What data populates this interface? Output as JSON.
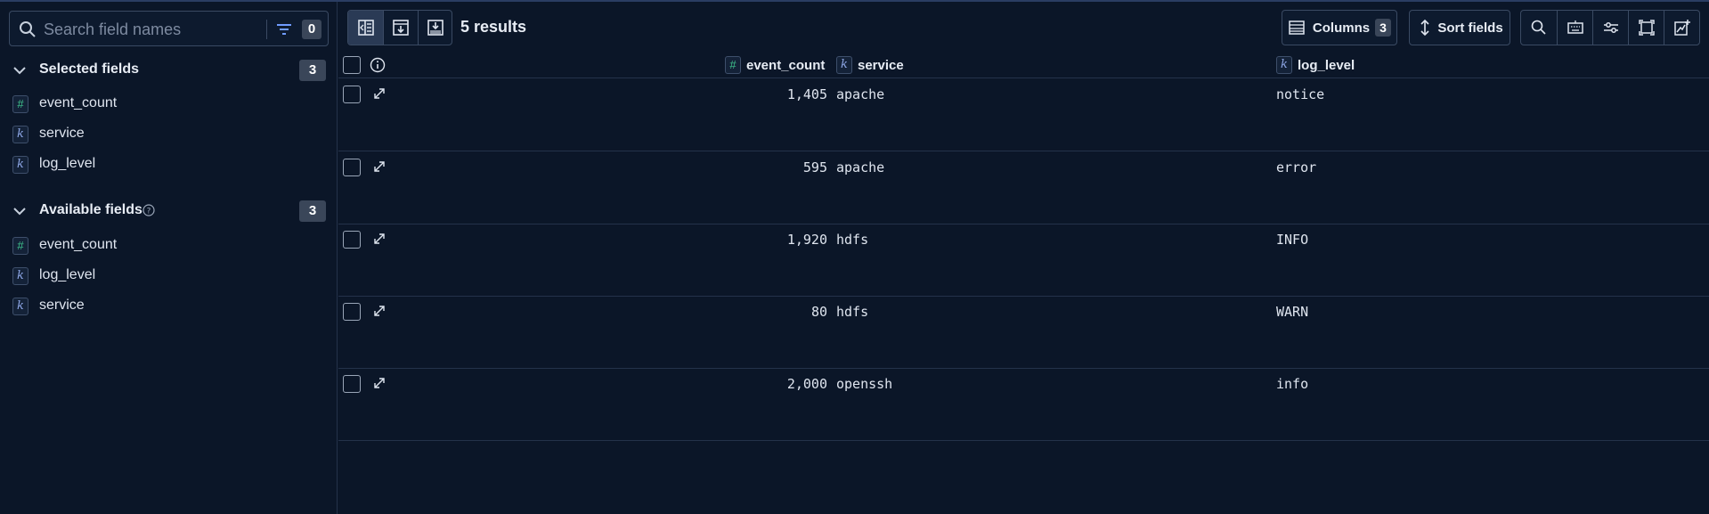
{
  "sidebar": {
    "search": {
      "placeholder": "Search field names",
      "value": "",
      "filter_count": "0"
    },
    "selected": {
      "title": "Selected fields",
      "count": "3",
      "items": [
        {
          "label": "event_count",
          "type": "#"
        },
        {
          "label": "service",
          "type": "k"
        },
        {
          "label": "log_level",
          "type": "k"
        }
      ]
    },
    "available": {
      "title": "Available fields",
      "count": "3",
      "items": [
        {
          "label": "event_count",
          "type": "#"
        },
        {
          "label": "log_level",
          "type": "k"
        },
        {
          "label": "service",
          "type": "k"
        }
      ]
    }
  },
  "toolbar": {
    "results_label": "5 results",
    "columns_label": "Columns",
    "columns_count": "3",
    "sort_label": "Sort fields"
  },
  "table": {
    "columns": [
      {
        "name": "event_count",
        "type": "#"
      },
      {
        "name": "service",
        "type": "k"
      },
      {
        "name": "log_level",
        "type": "k"
      }
    ],
    "rows": [
      {
        "event_count": "1,405",
        "service": "apache",
        "log_level": "notice"
      },
      {
        "event_count": "595",
        "service": "apache",
        "log_level": "error"
      },
      {
        "event_count": "1,920",
        "service": "hdfs",
        "log_level": "INFO"
      },
      {
        "event_count": "80",
        "service": "hdfs",
        "log_level": "WARN"
      },
      {
        "event_count": "2,000",
        "service": "openssh",
        "log_level": "info"
      }
    ]
  },
  "colors": {
    "background": "#0b1628",
    "number_token": "#3fc28c",
    "keyword_token": "#8ea7e6",
    "badge_bg": "#3a4659"
  },
  "icons": [
    "search-icon",
    "filter-icon",
    "chevron-down-icon",
    "help-icon",
    "document-view-icon",
    "save-icon",
    "download-icon",
    "columns-icon",
    "sort-icon",
    "inspect-icon",
    "keyboard-icon",
    "settings-icon",
    "fullscreen-icon",
    "chart-icon",
    "info-icon",
    "expand-icon"
  ]
}
